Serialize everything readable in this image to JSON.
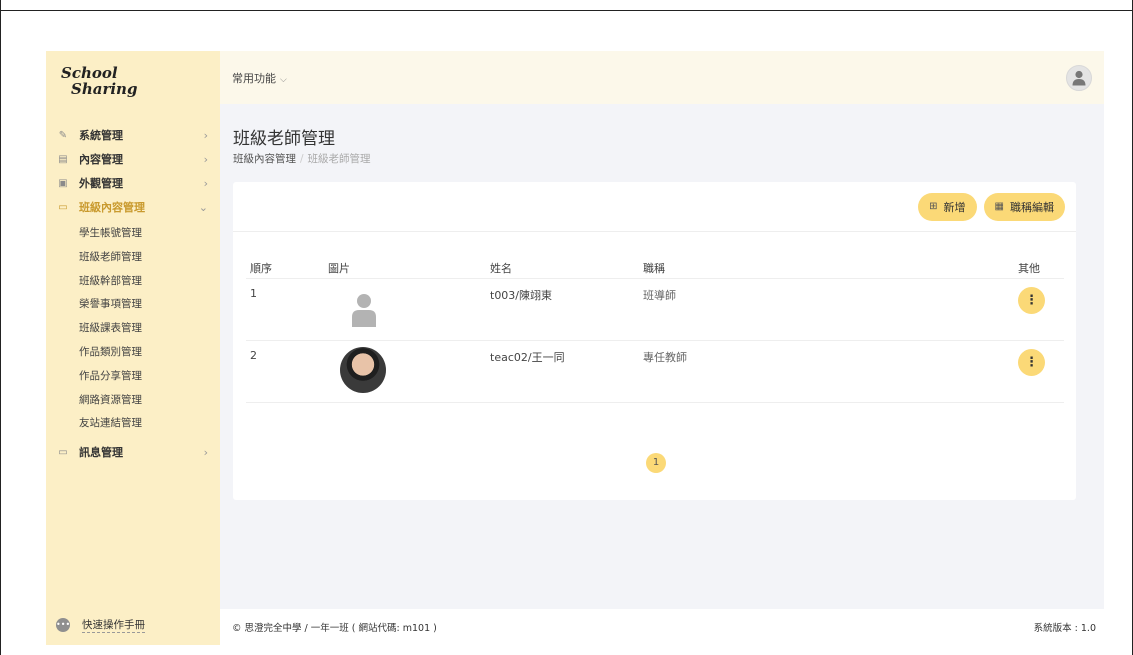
{
  "logo": {
    "line1": "School",
    "line2": "Sharing"
  },
  "sidebar": {
    "items": [
      {
        "label": "系統管理",
        "icon": "tools-icon"
      },
      {
        "label": "內容管理",
        "icon": "list-icon"
      },
      {
        "label": "外觀管理",
        "icon": "image-icon"
      },
      {
        "label": "班級內容管理",
        "icon": "folder-open-icon"
      },
      {
        "label": "訊息管理",
        "icon": "folder-icon"
      }
    ],
    "subitems": [
      "學生帳號管理",
      "班級老師管理",
      "班級幹部管理",
      "榮譽事項管理",
      "班級課表管理",
      "作品類別管理",
      "作品分享管理",
      "網路資源管理",
      "友站連結管理"
    ],
    "help": "快速操作手冊"
  },
  "topbar": {
    "quick": "常用功能"
  },
  "page": {
    "title": "班級老師管理",
    "breadcrumb": {
      "parent": "班級內容管理",
      "current": "班級老師管理"
    }
  },
  "buttons": {
    "add": "新增",
    "edit_titles": "職稱編輯"
  },
  "table": {
    "headers": [
      "順序",
      "圖片",
      "姓名",
      "職稱",
      "其他"
    ],
    "rows": [
      {
        "order": "1",
        "name": "t003/陳翊東",
        "title": "班導師"
      },
      {
        "order": "2",
        "name": "teac02/王一同",
        "title": "專任教師"
      }
    ]
  },
  "pagination": {
    "current": "1"
  },
  "footer": {
    "left": "© 思澄完全中學 / 一年一班 ( 網站代碼: m101 )",
    "right": "系統版本 : 1.0"
  },
  "colors": {
    "accent": "#fbd977",
    "sidebar_bg": "#fcefc6",
    "active": "#c99a2e"
  }
}
